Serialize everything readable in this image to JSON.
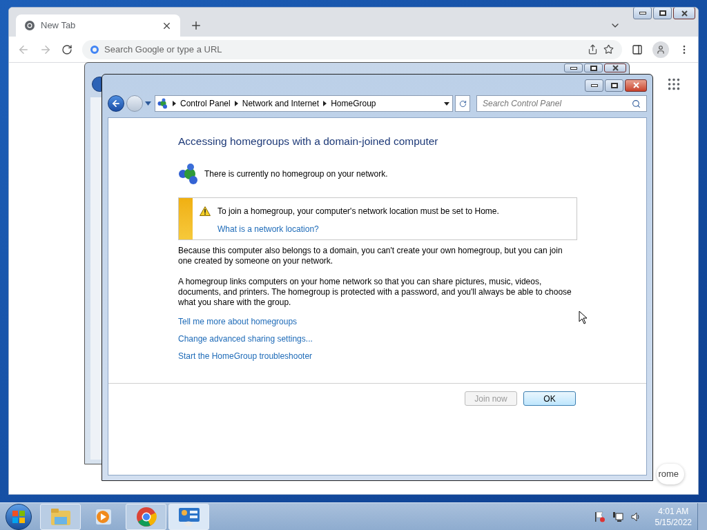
{
  "chrome": {
    "tab": {
      "title": "New Tab",
      "selected": true
    },
    "omnibox": {
      "placeholder": "Search Google or type a URL"
    },
    "customize_label": "rome"
  },
  "control_panel": {
    "breadcrumb": [
      "Control Panel",
      "Network and Internet",
      "HomeGroup"
    ],
    "search": {
      "placeholder": "Search Control Panel"
    },
    "heading": "Accessing homegroups with a domain-joined computer",
    "status": "There is currently no homegroup on your network.",
    "warning": {
      "text": "To join a homegroup, your computer's network location must be set to Home.",
      "link": "What is a network location?"
    },
    "paragraphs": [
      "Because this computer also belongs to a domain, you can't create your own homegroup, but you can join one created by someone on your network.",
      "A homegroup links computers on your home network so that you can share pictures, music, videos, documents, and printers. The homegroup is protected with a password, and you'll always be able to choose what you share with the group."
    ],
    "links": [
      "Tell me more about homegroups",
      "Change advanced sharing settings...",
      "Start the HomeGroup troubleshooter"
    ],
    "buttons": [
      {
        "label": "Join now",
        "disabled": true,
        "default": false
      },
      {
        "label": "OK",
        "disabled": false,
        "default": true
      }
    ]
  },
  "taskbar": {
    "items": [
      {
        "kind": "explorer",
        "running": true,
        "selected": false
      },
      {
        "kind": "media",
        "running": false,
        "selected": false
      },
      {
        "kind": "chrome",
        "running": true,
        "selected": false
      },
      {
        "kind": "control-panel",
        "running": true,
        "selected": true
      }
    ],
    "clock": {
      "time": "4:01 AM",
      "date": "5/15/2022"
    }
  }
}
